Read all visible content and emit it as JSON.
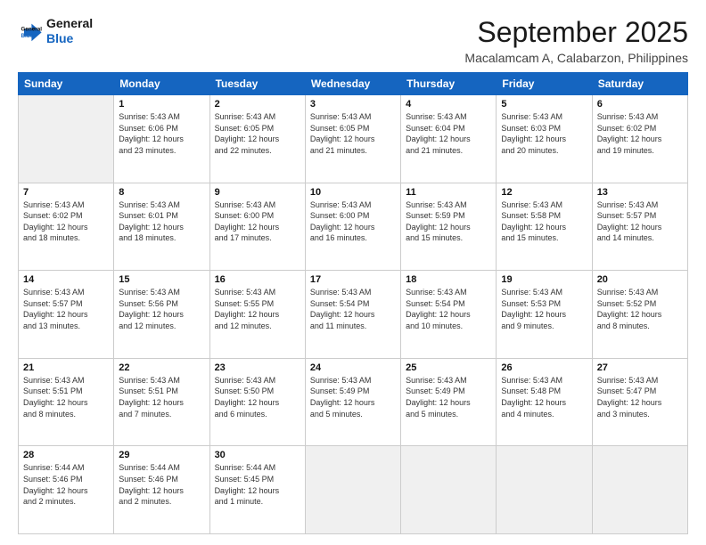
{
  "header": {
    "logo_line1": "General",
    "logo_line2": "Blue",
    "month": "September 2025",
    "location": "Macalamcam A, Calabarzon, Philippines"
  },
  "weekdays": [
    "Sunday",
    "Monday",
    "Tuesday",
    "Wednesday",
    "Thursday",
    "Friday",
    "Saturday"
  ],
  "weeks": [
    [
      {
        "num": "",
        "info": ""
      },
      {
        "num": "1",
        "info": "Sunrise: 5:43 AM\nSunset: 6:06 PM\nDaylight: 12 hours\nand 23 minutes."
      },
      {
        "num": "2",
        "info": "Sunrise: 5:43 AM\nSunset: 6:05 PM\nDaylight: 12 hours\nand 22 minutes."
      },
      {
        "num": "3",
        "info": "Sunrise: 5:43 AM\nSunset: 6:05 PM\nDaylight: 12 hours\nand 21 minutes."
      },
      {
        "num": "4",
        "info": "Sunrise: 5:43 AM\nSunset: 6:04 PM\nDaylight: 12 hours\nand 21 minutes."
      },
      {
        "num": "5",
        "info": "Sunrise: 5:43 AM\nSunset: 6:03 PM\nDaylight: 12 hours\nand 20 minutes."
      },
      {
        "num": "6",
        "info": "Sunrise: 5:43 AM\nSunset: 6:02 PM\nDaylight: 12 hours\nand 19 minutes."
      }
    ],
    [
      {
        "num": "7",
        "info": "Sunrise: 5:43 AM\nSunset: 6:02 PM\nDaylight: 12 hours\nand 18 minutes."
      },
      {
        "num": "8",
        "info": "Sunrise: 5:43 AM\nSunset: 6:01 PM\nDaylight: 12 hours\nand 18 minutes."
      },
      {
        "num": "9",
        "info": "Sunrise: 5:43 AM\nSunset: 6:00 PM\nDaylight: 12 hours\nand 17 minutes."
      },
      {
        "num": "10",
        "info": "Sunrise: 5:43 AM\nSunset: 6:00 PM\nDaylight: 12 hours\nand 16 minutes."
      },
      {
        "num": "11",
        "info": "Sunrise: 5:43 AM\nSunset: 5:59 PM\nDaylight: 12 hours\nand 15 minutes."
      },
      {
        "num": "12",
        "info": "Sunrise: 5:43 AM\nSunset: 5:58 PM\nDaylight: 12 hours\nand 15 minutes."
      },
      {
        "num": "13",
        "info": "Sunrise: 5:43 AM\nSunset: 5:57 PM\nDaylight: 12 hours\nand 14 minutes."
      }
    ],
    [
      {
        "num": "14",
        "info": "Sunrise: 5:43 AM\nSunset: 5:57 PM\nDaylight: 12 hours\nand 13 minutes."
      },
      {
        "num": "15",
        "info": "Sunrise: 5:43 AM\nSunset: 5:56 PM\nDaylight: 12 hours\nand 12 minutes."
      },
      {
        "num": "16",
        "info": "Sunrise: 5:43 AM\nSunset: 5:55 PM\nDaylight: 12 hours\nand 12 minutes."
      },
      {
        "num": "17",
        "info": "Sunrise: 5:43 AM\nSunset: 5:54 PM\nDaylight: 12 hours\nand 11 minutes."
      },
      {
        "num": "18",
        "info": "Sunrise: 5:43 AM\nSunset: 5:54 PM\nDaylight: 12 hours\nand 10 minutes."
      },
      {
        "num": "19",
        "info": "Sunrise: 5:43 AM\nSunset: 5:53 PM\nDaylight: 12 hours\nand 9 minutes."
      },
      {
        "num": "20",
        "info": "Sunrise: 5:43 AM\nSunset: 5:52 PM\nDaylight: 12 hours\nand 8 minutes."
      }
    ],
    [
      {
        "num": "21",
        "info": "Sunrise: 5:43 AM\nSunset: 5:51 PM\nDaylight: 12 hours\nand 8 minutes."
      },
      {
        "num": "22",
        "info": "Sunrise: 5:43 AM\nSunset: 5:51 PM\nDaylight: 12 hours\nand 7 minutes."
      },
      {
        "num": "23",
        "info": "Sunrise: 5:43 AM\nSunset: 5:50 PM\nDaylight: 12 hours\nand 6 minutes."
      },
      {
        "num": "24",
        "info": "Sunrise: 5:43 AM\nSunset: 5:49 PM\nDaylight: 12 hours\nand 5 minutes."
      },
      {
        "num": "25",
        "info": "Sunrise: 5:43 AM\nSunset: 5:49 PM\nDaylight: 12 hours\nand 5 minutes."
      },
      {
        "num": "26",
        "info": "Sunrise: 5:43 AM\nSunset: 5:48 PM\nDaylight: 12 hours\nand 4 minutes."
      },
      {
        "num": "27",
        "info": "Sunrise: 5:43 AM\nSunset: 5:47 PM\nDaylight: 12 hours\nand 3 minutes."
      }
    ],
    [
      {
        "num": "28",
        "info": "Sunrise: 5:44 AM\nSunset: 5:46 PM\nDaylight: 12 hours\nand 2 minutes."
      },
      {
        "num": "29",
        "info": "Sunrise: 5:44 AM\nSunset: 5:46 PM\nDaylight: 12 hours\nand 2 minutes."
      },
      {
        "num": "30",
        "info": "Sunrise: 5:44 AM\nSunset: 5:45 PM\nDaylight: 12 hours\nand 1 minute."
      },
      {
        "num": "",
        "info": ""
      },
      {
        "num": "",
        "info": ""
      },
      {
        "num": "",
        "info": ""
      },
      {
        "num": "",
        "info": ""
      }
    ]
  ]
}
